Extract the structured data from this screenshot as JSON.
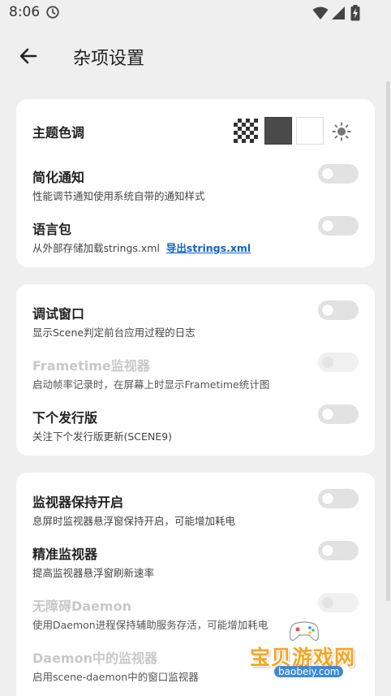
{
  "status_bar": {
    "time": "8:06",
    "icons": [
      "clock-icon",
      "wifi-icon",
      "signal-icon",
      "battery-charging-icon"
    ]
  },
  "header": {
    "title": "杂项设置",
    "back_icon": "arrow-left-icon"
  },
  "colors": {
    "background": "#efefef",
    "card": "#ffffff",
    "link": "#1565c0",
    "toggle_off": "#e2e2e2",
    "disabled_text": "#c8c8c8",
    "watermark_orange": "#f5a623",
    "watermark_blue": "#3c8ad8"
  },
  "cards": [
    {
      "theme": {
        "label": "主题色调",
        "swatches": [
          "transparent-checker",
          "dark",
          "light"
        ],
        "extra_icon": "sun-icon"
      },
      "items": [
        {
          "title": "简化通知",
          "desc": "性能调节通知使用系统自带的通知样式",
          "enabled": true,
          "checked": false
        },
        {
          "title": "语言包",
          "desc": "从外部存储加载strings.xml",
          "link": "导出strings.xml",
          "enabled": true,
          "checked": false
        }
      ]
    },
    {
      "items": [
        {
          "title": "调试窗口",
          "desc": "显示Scene判定前台应用过程的日志",
          "enabled": true,
          "checked": false
        },
        {
          "title": "Frametime监视器",
          "desc": "启动帧率记录时，在屏幕上时显示Frametime统计图",
          "enabled": false,
          "checked": false
        },
        {
          "title": "下个发行版",
          "desc": "关注下个发行版更新(SCENE9)",
          "enabled": true,
          "checked": false
        }
      ]
    },
    {
      "items": [
        {
          "title": "监视器保持开启",
          "desc": "息屏时监视器悬浮窗保持开启，可能增加耗电",
          "enabled": true,
          "checked": false
        },
        {
          "title": "精准监视器",
          "desc": "提高监视器悬浮窗刷新速率",
          "enabled": true,
          "checked": false
        },
        {
          "title": "无障碍Daemon",
          "desc": "使用Daemon进程保持辅助服务存活，可能增加耗电",
          "enabled": false,
          "checked": false
        },
        {
          "title": "Daemon中的监视器",
          "desc": "启用scene-daemon中的窗口监视器",
          "enabled": false,
          "checked": false
        }
      ]
    }
  ],
  "watermark": {
    "text": "宝贝游戏网",
    "url": "baobeiy.com",
    "icon": "gamepad-icon"
  }
}
